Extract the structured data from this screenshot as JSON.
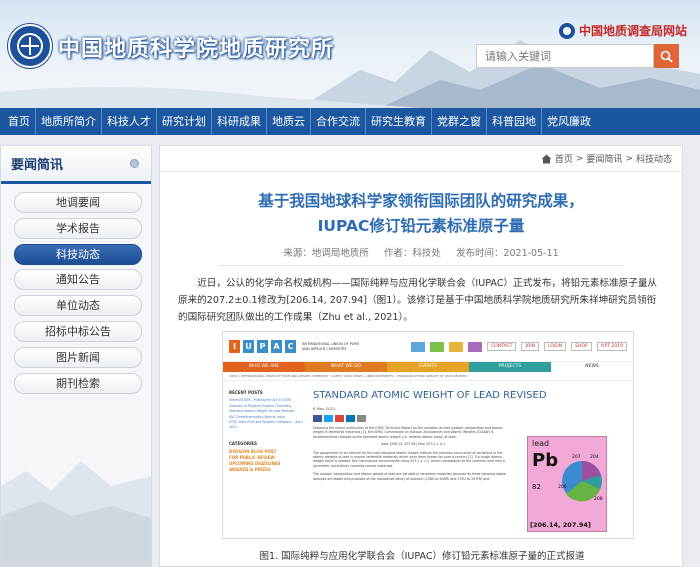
{
  "header": {
    "site_title": "中国地质科学院地质研究所",
    "cgs_link": "中国地质调查局网站",
    "search_placeholder": "请输入关键词",
    "logo_text": "CHINESE ACADEMY OF GEOLOGICAL SCIENCES"
  },
  "nav": {
    "items": [
      "首页",
      "地质所简介",
      "科技人才",
      "研究计划",
      "科研成果",
      "地质云",
      "合作交流",
      "研究生教育",
      "党群之窗",
      "科普园地",
      "党风廉政"
    ]
  },
  "sidebar": {
    "title": "要闻简讯",
    "items": [
      {
        "label": "地调要闻",
        "active": false
      },
      {
        "label": "学术报告",
        "active": false
      },
      {
        "label": "科技动态",
        "active": true
      },
      {
        "label": "通知公告",
        "active": false
      },
      {
        "label": "单位动态",
        "active": false
      },
      {
        "label": "招标中标公告",
        "active": false
      },
      {
        "label": "图片新闻",
        "active": false
      },
      {
        "label": "期刊检索",
        "active": false
      }
    ]
  },
  "breadcrumb": {
    "items": [
      "首页",
      "要闻简讯",
      "科技动态"
    ],
    "separator": ">"
  },
  "article": {
    "title_line1": "基于我国地球科学家领衔国际团队的研究成果，",
    "title_line2": "IUPAC修订铅元素标准原子量",
    "source": "来源：地调局地质所",
    "author": "作者：科技处",
    "date": "发布时间：2021-05-11",
    "paragraph": "近日，公认的化学命名权威机构——国际纯粹与应用化学联合会（IUPAC）正式发布，将铅元素标准原子量从原来的207.2±0.1修改为[206.14, 207.94]（图1）。该修订是基于中国地质科学院地质研究所朱祥坤研究员领衔的国际研究团队做出的工作成果（Zhu et al., 2021）。",
    "caption": "图1. 国际纯粹与应用化学联合会（IUPAC）修订铅元素标准原子量的正式报道"
  },
  "figure": {
    "iupac_letters": [
      "I",
      "U",
      "P",
      "A",
      "C"
    ],
    "iupac_subtitle": "INTERNATIONAL UNION OF PURE AND APPLIED CHEMISTRY",
    "buttons": [
      "CONTACT",
      "JOIN",
      "LOGIN",
      "SHOP",
      "IYPT 2019"
    ],
    "nav": [
      "WHO WE ARE",
      "WHAT WE DO",
      "EVENTS",
      "PROJECTS",
      "NEWS"
    ],
    "crumb": "IUPAC | INTERNATIONAL UNION OF PURE AND APPLIED CHEMISTRY › LATEST IUPAC NEWS › ANNOUNCEMENTS › STANDARD ATOMIC WEIGHT OF LEAD REVISED",
    "recent_posts_title": "RECENT POSTS",
    "recent_posts": [
      "ChemVISTEM – Putting the Art in STEM",
      "Glossary of Physical Organic Chemistry",
      "Standard Atomic Weight of Lead Revised",
      "PAC Chemithermatics Special Issue",
      "eTOC Alert Pure and Applied Chemistry – April 2021"
    ],
    "categories_title": "CATEGORIES",
    "categories": [
      "DIVISION BLOG POST",
      "FOR PUBLIC REVIEW",
      "UPCOMING DEADLINES",
      "AWARDS & PRIZES"
    ],
    "headline": "STANDARD ATOMIC WEIGHT OF LEAD REVISED",
    "date": "6 May 2021",
    "text1": "Following the recent publication of the IUPAC Technical Report on the variation of lead isotopic composition and atomic weight in terrestrial materials [1], the IUPAC Commission on Isotopic Abundances and Atomic Weights (CIAAW) is recommending changes to the standard atomic weight (i.e. relative atomic mass) of lead:",
    "formula": "lead: [206.14, 207.94] from 207.2 ± 0.1",
    "text2": "The assignment of an interval for the new standard atomic weight reflects the common occurrence of variations in the atomic weights of lead in normal terrestrial materials which have been known for over a century [2]. If a single atomic-weight value is needed, the Commission recommends using 207.2 ± 1.1, which corresponds to the common lead with a symmetric uncertainty covering normal materials.",
    "text3": "The isotopic composition and atomic weight of lead are variable in terrestrial materials because its three heaviest stable isotopes are stable end-products of the radioactive decay of uranium (238U to 206Pb and 235U to 207Pb) and",
    "element": {
      "name": "lead",
      "symbol": "Pb",
      "number": "82",
      "range": "[206.14, 207.94]",
      "isotopes": [
        "207",
        "204",
        "206",
        "208"
      ]
    }
  }
}
